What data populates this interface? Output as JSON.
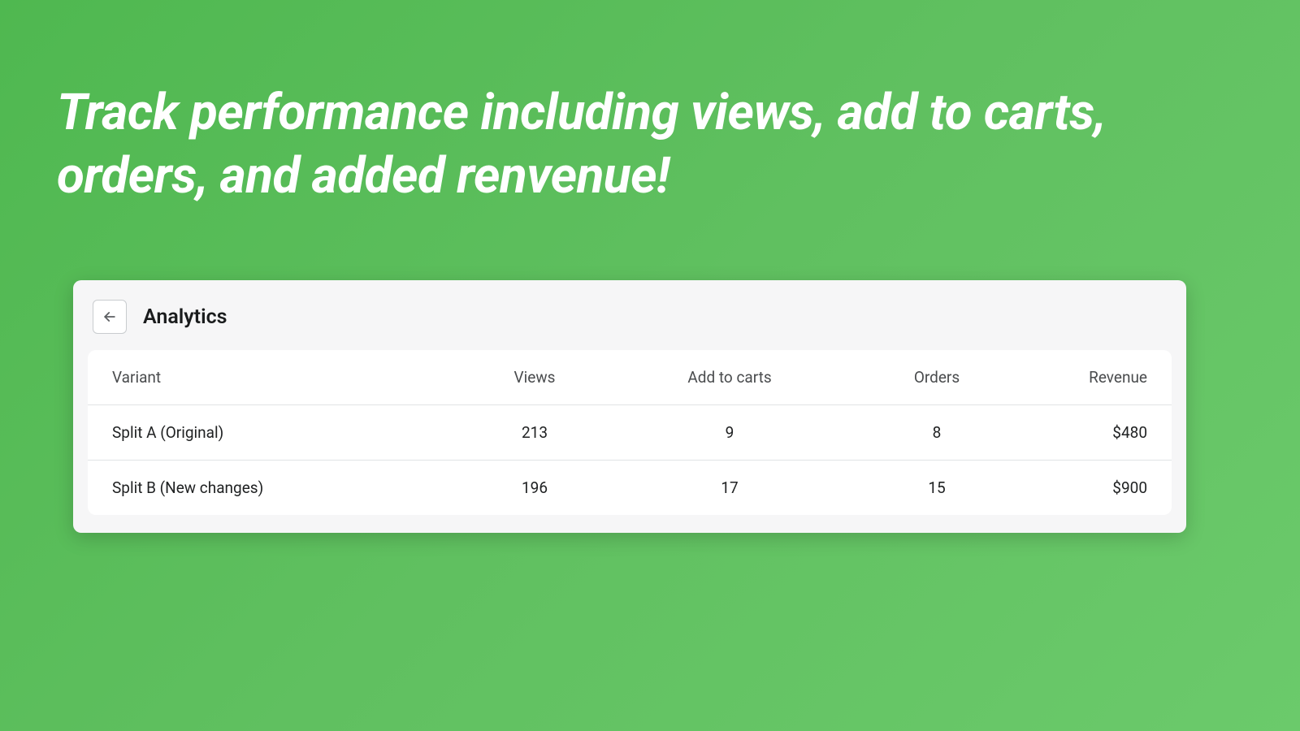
{
  "headline": "Track performance including views, add to carts, orders, and added renvenue!",
  "panel": {
    "title": "Analytics"
  },
  "table": {
    "headers": {
      "variant": "Variant",
      "views": "Views",
      "add_to_carts": "Add to carts",
      "orders": "Orders",
      "revenue": "Revenue"
    },
    "rows": [
      {
        "variant": "Split A (Original)",
        "views": "213",
        "add_to_carts": "9",
        "orders": "8",
        "revenue": "$480"
      },
      {
        "variant": "Split B (New changes)",
        "views": "196",
        "add_to_carts": "17",
        "orders": "15",
        "revenue": "$900"
      }
    ]
  }
}
